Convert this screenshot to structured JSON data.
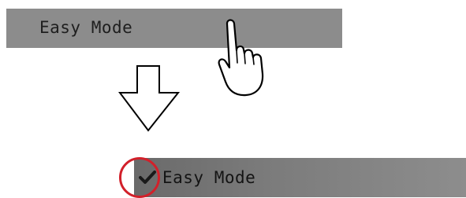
{
  "menu_before": {
    "label": "Easy Mode"
  },
  "menu_after": {
    "label": "Easy Mode",
    "checked": true
  },
  "icons": {
    "pointer": "hand-pointer-icon",
    "arrow": "down-arrow-icon",
    "check": "checkmark-icon"
  },
  "colors": {
    "menu_bg_before": "#8c8c8c",
    "menu_bg_after": "#6a6a6a",
    "highlight": "#d2202a"
  }
}
